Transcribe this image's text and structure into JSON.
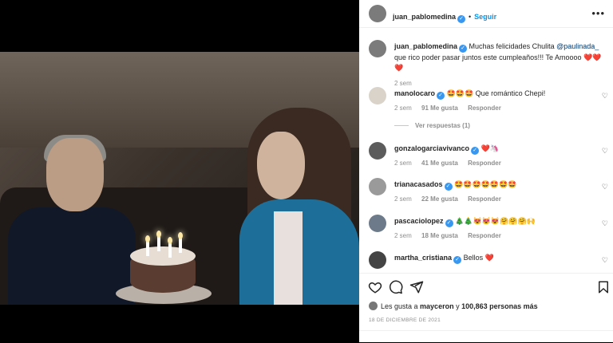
{
  "post": {
    "author": "juan_pablomedina",
    "follow_label": "Seguir",
    "dot": "•",
    "more_label": "•••",
    "caption_text": "Muchas felicidades Chulita ",
    "caption_mention": "@paulinada_",
    "caption_rest": " que rico poder pasar juntos este cumpleaños!!! Te Amoooo ❤️❤️❤️",
    "caption_time": "2 sem",
    "likes_prefix": "Les gusta a ",
    "likes_user": "mayceron",
    "likes_mid": " y ",
    "likes_count": "100,863 personas más",
    "date": "18 DE DICIEMBRE DE 2021"
  },
  "comments": [
    {
      "user": "manolocaro",
      "text": "🤩🤩🤩 Que romántico Chepi!",
      "time": "2 sem",
      "likes": "91 Me gusta",
      "reply": "Responder",
      "replies": "Ver respuestas (1)"
    },
    {
      "user": "gonzalogarciavivanco",
      "text": "❤️🦄",
      "time": "2 sem",
      "likes": "41 Me gusta",
      "reply": "Responder"
    },
    {
      "user": "trianacasados",
      "text": "🤩🤩🤩🤩🤩🤩🤩",
      "time": "2 sem",
      "likes": "22 Me gusta",
      "reply": "Responder"
    },
    {
      "user": "pascaciolopez",
      "text": "🎄🎄😻😻😻🤗🤗🤗🙌",
      "time": "2 sem",
      "likes": "18 Me gusta",
      "reply": "Responder"
    },
    {
      "user": "martha_cristiana",
      "text": "Bellos ❤️"
    }
  ],
  "icons": {
    "like": "heart-icon",
    "comment": "comment-icon",
    "share": "send-icon",
    "save": "bookmark-icon",
    "verified": "verified-badge-icon"
  },
  "colors": {
    "accent": "#0095f6",
    "verified": "#3897f0",
    "muted": "#8e8e8e"
  }
}
